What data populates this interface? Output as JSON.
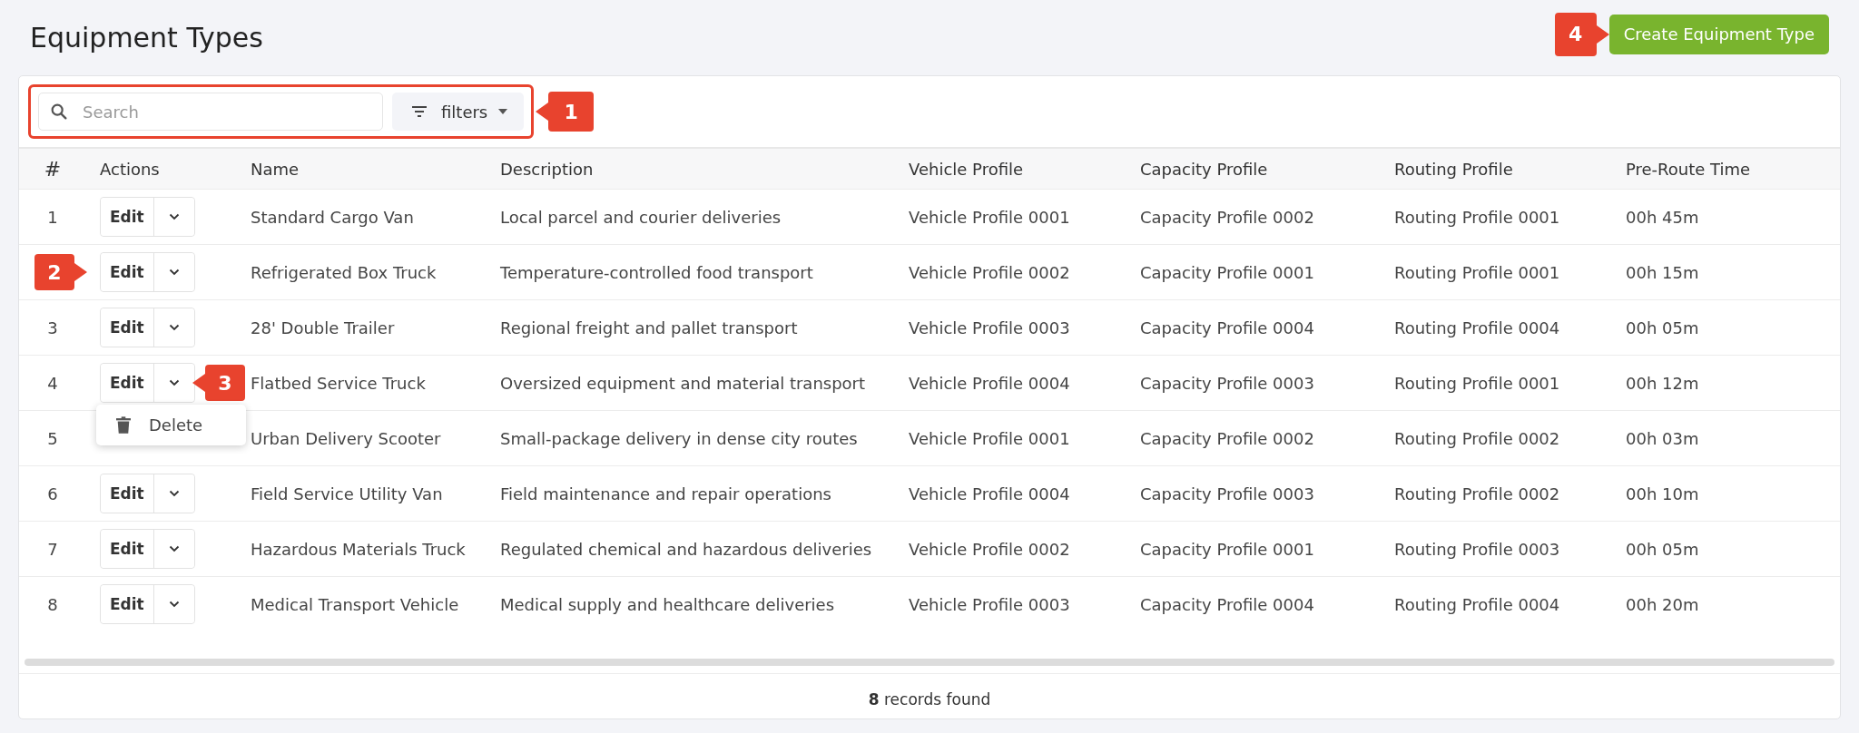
{
  "page": {
    "title": "Equipment Types"
  },
  "create_button": {
    "label": "Create Equipment Type",
    "callout": {
      "number": "4",
      "kind": "pointer-right"
    }
  },
  "toolbar": {
    "highlighted": true,
    "search": {
      "placeholder": "Search"
    },
    "filters_button": {
      "label": "filters"
    },
    "callout": {
      "number": "1",
      "kind": "pointer-left"
    }
  },
  "table": {
    "columns": [
      "#",
      "Actions",
      "Name",
      "Description",
      "Vehicle Profile",
      "Capacity Profile",
      "Routing Profile",
      "Pre-Route Time"
    ],
    "rows": [
      {
        "index": "1",
        "edit": "Edit",
        "name": "Standard Cargo Van",
        "description": "Local parcel and courier deliveries",
        "vehicle_profile": "Vehicle Profile 0001",
        "capacity_profile": "Capacity Profile 0002",
        "routing_profile": "Routing Profile 0001",
        "pre_route_time": "00h 45m"
      },
      {
        "edit": "Edit",
        "name": "Refrigerated Box Truck",
        "description": "Temperature-controlled food transport",
        "vehicle_profile": "Vehicle Profile 0002",
        "capacity_profile": "Capacity Profile 0001",
        "routing_profile": "Routing Profile 0001",
        "pre_route_time": "00h 15m",
        "callout": {
          "number": "2",
          "kind": "pointer-right"
        }
      },
      {
        "index": "3",
        "edit": "Edit",
        "name": "28' Double Trailer",
        "description": "Regional freight and pallet transport",
        "vehicle_profile": "Vehicle Profile 0003",
        "capacity_profile": "Capacity Profile 0004",
        "routing_profile": "Routing Profile 0004",
        "pre_route_time": "00h 05m"
      },
      {
        "index": "4",
        "edit": "Edit",
        "name": "Flatbed Service Truck",
        "description": "Oversized equipment and material transport",
        "vehicle_profile": "Vehicle Profile 0004",
        "capacity_profile": "Capacity Profile 0003",
        "routing_profile": "Routing Profile 0001",
        "pre_route_time": "00h 12m",
        "callout": {
          "number": "3",
          "kind": "pointer-left"
        },
        "menu": {
          "items": [
            {
              "label": "Delete"
            }
          ]
        }
      },
      {
        "index": "5",
        "name": "Urban Delivery Scooter",
        "description": "Small-package delivery in dense city routes",
        "vehicle_profile": "Vehicle Profile 0001",
        "capacity_profile": "Capacity Profile 0002",
        "routing_profile": "Routing Profile 0002",
        "pre_route_time": "00h 03m"
      },
      {
        "index": "6",
        "edit": "Edit",
        "name": "Field Service Utility Van",
        "description": "Field maintenance and repair operations",
        "vehicle_profile": "Vehicle Profile 0004",
        "capacity_profile": "Capacity Profile 0003",
        "routing_profile": "Routing Profile 0002",
        "pre_route_time": "00h 10m"
      },
      {
        "index": "7",
        "edit": "Edit",
        "name": "Hazardous Materials Truck",
        "description": "Regulated chemical and hazardous deliveries",
        "vehicle_profile": "Vehicle Profile 0002",
        "capacity_profile": "Capacity Profile 0001",
        "routing_profile": "Routing Profile 0003",
        "pre_route_time": "00h 05m"
      },
      {
        "index": "8",
        "edit": "Edit",
        "name": "Medical Transport Vehicle",
        "description": "Medical supply and healthcare deliveries",
        "vehicle_profile": "Vehicle Profile 0003",
        "capacity_profile": "Capacity Profile 0004",
        "routing_profile": "Routing Profile 0004",
        "pre_route_time": "00h 20m"
      }
    ]
  },
  "footer": {
    "text": "**8** records found"
  }
}
